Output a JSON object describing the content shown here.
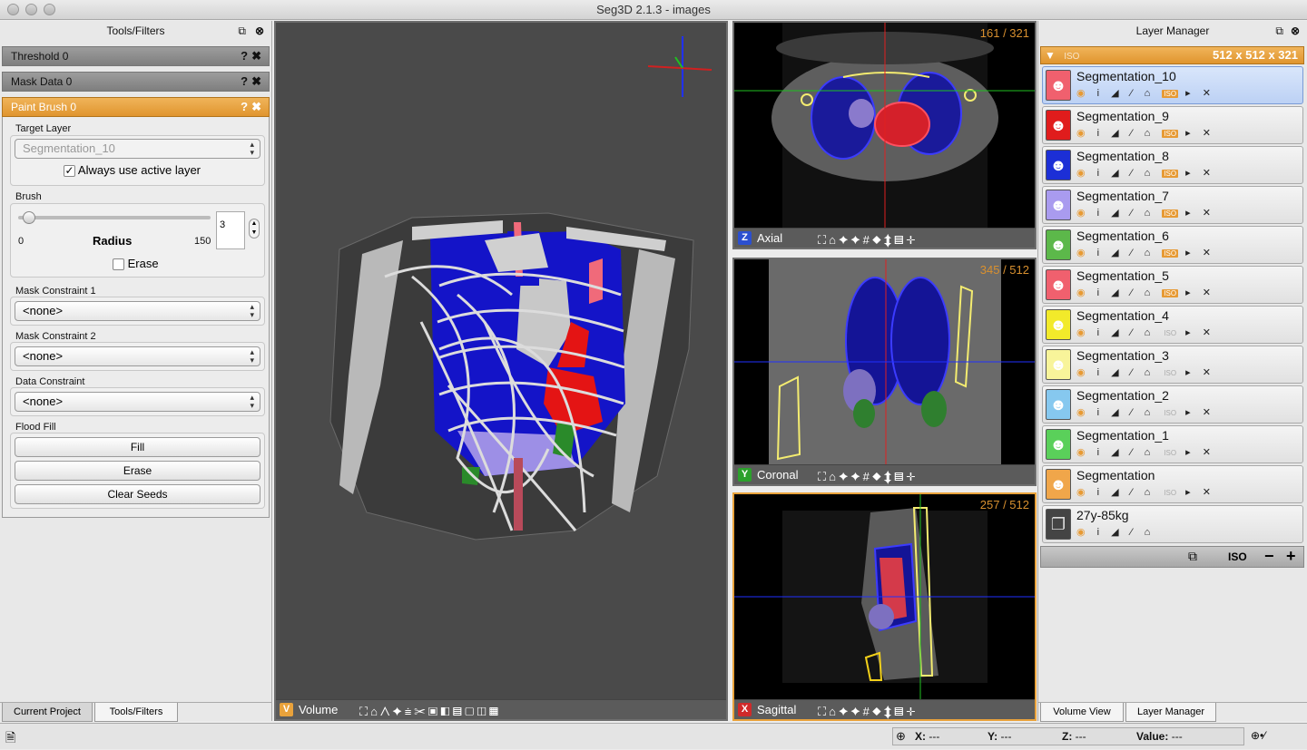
{
  "window": {
    "title": "Seg3D  2.1.3 - images"
  },
  "tools_panel": {
    "title": "Tools/Filters",
    "tools": [
      {
        "label": "Threshold 0",
        "active": false
      },
      {
        "label": "Mask Data 0",
        "active": false
      },
      {
        "label": "Paint Brush 0",
        "active": true
      }
    ],
    "target_layer_label": "Target Layer",
    "target_layer_value": "Segmentation_10",
    "always_active_label": "Always use active layer",
    "always_active_checked": true,
    "brush_label": "Brush",
    "radius_label": "Radius",
    "radius_min": "0",
    "radius_max": "150",
    "radius_value": "3",
    "erase_label": "Erase",
    "mask_constraint_1_label": "Mask Constraint 1",
    "mask_constraint_1_value": "<none>",
    "mask_constraint_2_label": "Mask Constraint 2",
    "mask_constraint_2_value": "<none>",
    "data_constraint_label": "Data Constraint",
    "data_constraint_value": "<none>",
    "flood_fill_label": "Flood Fill",
    "fill_button": "Fill",
    "erase_button": "Erase",
    "clear_seeds_button": "Clear Seeds",
    "bottom_tabs": [
      "Current Project",
      "Tools/Filters"
    ]
  },
  "viewers": {
    "volume": {
      "key": "V",
      "label": "Volume"
    },
    "axial": {
      "key": "Z",
      "label": "Axial",
      "slice": "161 / 321"
    },
    "coronal": {
      "key": "Y",
      "label": "Coronal",
      "slice": "345 / 512"
    },
    "sagittal": {
      "key": "X",
      "label": "Sagittal",
      "slice": "257 / 512"
    }
  },
  "layer_manager": {
    "title": "Layer Manager",
    "group_iso": "ISO",
    "group_size": "512 x 512 x 321",
    "layers": [
      {
        "name": "Segmentation_10",
        "color": "#f0606e",
        "selected": true
      },
      {
        "name": "Segmentation_9",
        "color": "#e01c1c",
        "selected": false
      },
      {
        "name": "Segmentation_8",
        "color": "#1c2fd6",
        "selected": false
      },
      {
        "name": "Segmentation_7",
        "color": "#a99bef",
        "selected": false
      },
      {
        "name": "Segmentation_6",
        "color": "#5cb84a",
        "selected": false
      },
      {
        "name": "Segmentation_5",
        "color": "#f0606e",
        "selected": false
      },
      {
        "name": "Segmentation_4",
        "color": "#f2ea2a",
        "selected": false
      },
      {
        "name": "Segmentation_3",
        "color": "#f8f49a",
        "selected": false
      },
      {
        "name": "Segmentation_2",
        "color": "#86c8ef",
        "selected": false
      },
      {
        "name": "Segmentation_1",
        "color": "#5ad05a",
        "selected": false
      },
      {
        "name": "Segmentation",
        "color": "#f0a64a",
        "selected": false
      },
      {
        "name": "27y-85kg",
        "color": "#444444",
        "selected": false
      }
    ],
    "footer_iso": "ISO",
    "footer_minus": "−",
    "footer_plus": "+",
    "bottom_tabs": [
      "Volume View",
      "Layer Manager"
    ]
  },
  "statusbar": {
    "x_label": "X:",
    "x_value": "---",
    "y_label": "Y:",
    "y_value": "---",
    "z_label": "Z:",
    "z_value": "---",
    "value_label": "Value:",
    "value_value": "---"
  },
  "colors": {
    "accent": "#e9a23b",
    "viewer_bg": "#4a4a4a"
  }
}
